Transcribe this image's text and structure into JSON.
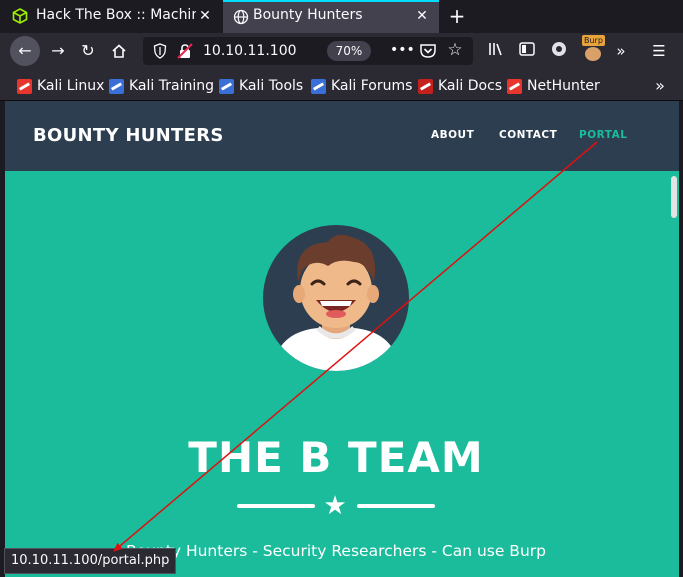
{
  "browser": {
    "tabs": [
      {
        "title": "Hack The Box :: Machines",
        "active": false
      },
      {
        "title": "Bounty Hunters",
        "active": true
      }
    ],
    "url": "10.10.11.100",
    "zoom": "70%",
    "status_url": "10.10.11.100/portal.php",
    "extension_badge": "Burp",
    "colors": {
      "tab_active_accent": "#00ddff",
      "chrome_bg": "#2b2a33",
      "tabstrip_bg": "#1c1b22"
    }
  },
  "bookmarks": [
    {
      "label": "Kali Linux",
      "icon": "kali-dragon-icon"
    },
    {
      "label": "Kali Training",
      "icon": "kali-training-icon"
    },
    {
      "label": "Kali Tools",
      "icon": "kali-tools-icon"
    },
    {
      "label": "Kali Forums",
      "icon": "kali-forums-icon"
    },
    {
      "label": "Kali Docs",
      "icon": "kali-docs-icon"
    },
    {
      "label": "NetHunter",
      "icon": "nethunter-icon"
    }
  ],
  "site": {
    "brand": "BOUNTY HUNTERS",
    "nav": [
      {
        "label": "ABOUT"
      },
      {
        "label": "CONTACT"
      },
      {
        "label": "PORTAL",
        "highlighted": true
      }
    ],
    "heading": "THE B TEAM",
    "subtitle": "Bounty Hunters - Security Researchers - Can use Burp",
    "colors": {
      "navbar": "#2c3e50",
      "masthead": "#1abc9c",
      "annotation_arrow": "#e01010"
    }
  }
}
